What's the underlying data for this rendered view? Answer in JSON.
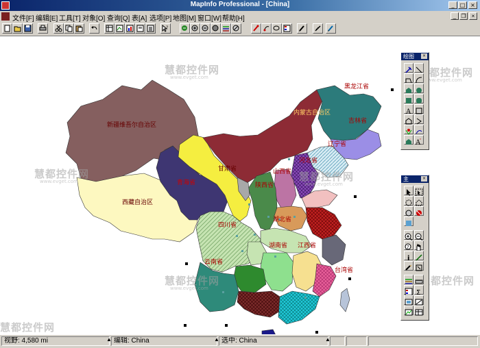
{
  "window": {
    "title": "MapInfo Professional - [China]"
  },
  "menu": [
    {
      "label": "文件[F]"
    },
    {
      "label": "编辑[E]"
    },
    {
      "label": "工具[T]"
    },
    {
      "label": "对象[O]"
    },
    {
      "label": "查询[Q]"
    },
    {
      "label": "表[A]"
    },
    {
      "label": "选项[P]"
    },
    {
      "label": "地图[M]"
    },
    {
      "label": "窗口[W]"
    },
    {
      "label": "帮助[H]"
    }
  ],
  "palettes": {
    "drawing": {
      "title": "绘图"
    },
    "main": {
      "title": "主"
    }
  },
  "provinces": {
    "xinjiang": "新疆维吾尔自治区",
    "xizang": "西藏自治区",
    "qinghai": "青海省",
    "gansu": "甘肃省",
    "neimenggu": "内蒙古自治区",
    "heilongjiang": "黑龙江省",
    "jilin": "吉林省",
    "liaoning": "辽宁省",
    "hebei": "河北省",
    "shanxi": "山西省",
    "shaanxi": "陕西省",
    "sichuan": "四川省",
    "hubei": "湖北省",
    "hunan": "湖南省",
    "jiangxi": "江西省",
    "yunnan": "云南省",
    "taiwan": "台湾省"
  },
  "watermark": {
    "main": "慧都控件网",
    "url": "www.evget.com"
  },
  "status": {
    "zoom": "视野: 4,580 mi",
    "editing": "编辑: China",
    "selection": "选中: China"
  },
  "colors": {
    "xinjiang": "#855f5f",
    "xizang": "#fdf8c0",
    "qinghai": "#3e3672",
    "gansu": "#f5ee40",
    "neimenggu": "#8d2b35",
    "heilongjiang": "#2c7b7b",
    "jilin": "#9b8ee6",
    "sichuan": "#c6e4b2",
    "taiwan": "#b7c4d9"
  }
}
